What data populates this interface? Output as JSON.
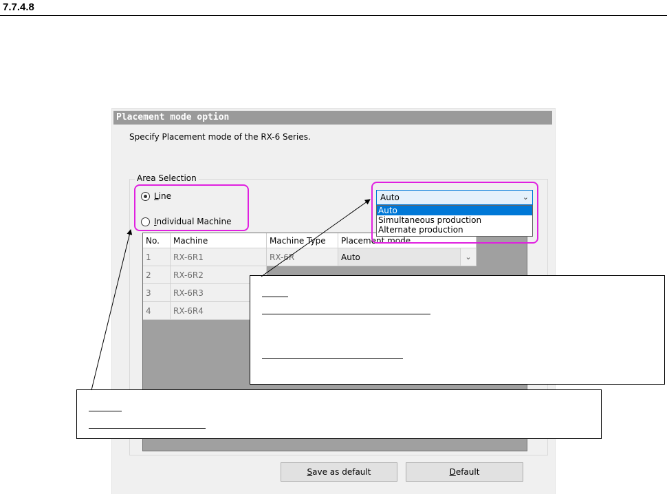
{
  "section_number": "7.7.4.8",
  "dialog": {
    "title": "Placement mode option",
    "description": "Specify Placement mode of the RX-6 Series.",
    "area_selection": {
      "legend": "Area Selection",
      "line_option": {
        "accel": "L",
        "rest": "ine",
        "checked": true
      },
      "individual_option": {
        "accel": "I",
        "rest": "ndividual Machine",
        "checked": false
      }
    },
    "combo": {
      "value": "Auto",
      "options": [
        "Auto",
        "Simultaneous production",
        "Alternate production"
      ]
    },
    "grid": {
      "headers": [
        "No.",
        "Machine",
        "Machine Type",
        "Placement mode"
      ],
      "rows": [
        {
          "no": "1",
          "machine": "RX-6R1",
          "type": "RX-6R",
          "mode": "Auto"
        },
        {
          "no": "2",
          "machine": "RX-6R2",
          "type": "",
          "mode": ""
        },
        {
          "no": "3",
          "machine": "RX-6R3",
          "type": "",
          "mode": ""
        },
        {
          "no": "4",
          "machine": "RX-6R4",
          "type": "",
          "mode": ""
        }
      ]
    },
    "buttons": {
      "save_default": {
        "accel": "S",
        "rest": "ave as default"
      },
      "default": {
        "accel": "D",
        "rest": "efault"
      }
    }
  },
  "colors": {
    "highlight": "#e020e0",
    "selection": "#0078d7",
    "title_bar": "#9a9a9a"
  }
}
